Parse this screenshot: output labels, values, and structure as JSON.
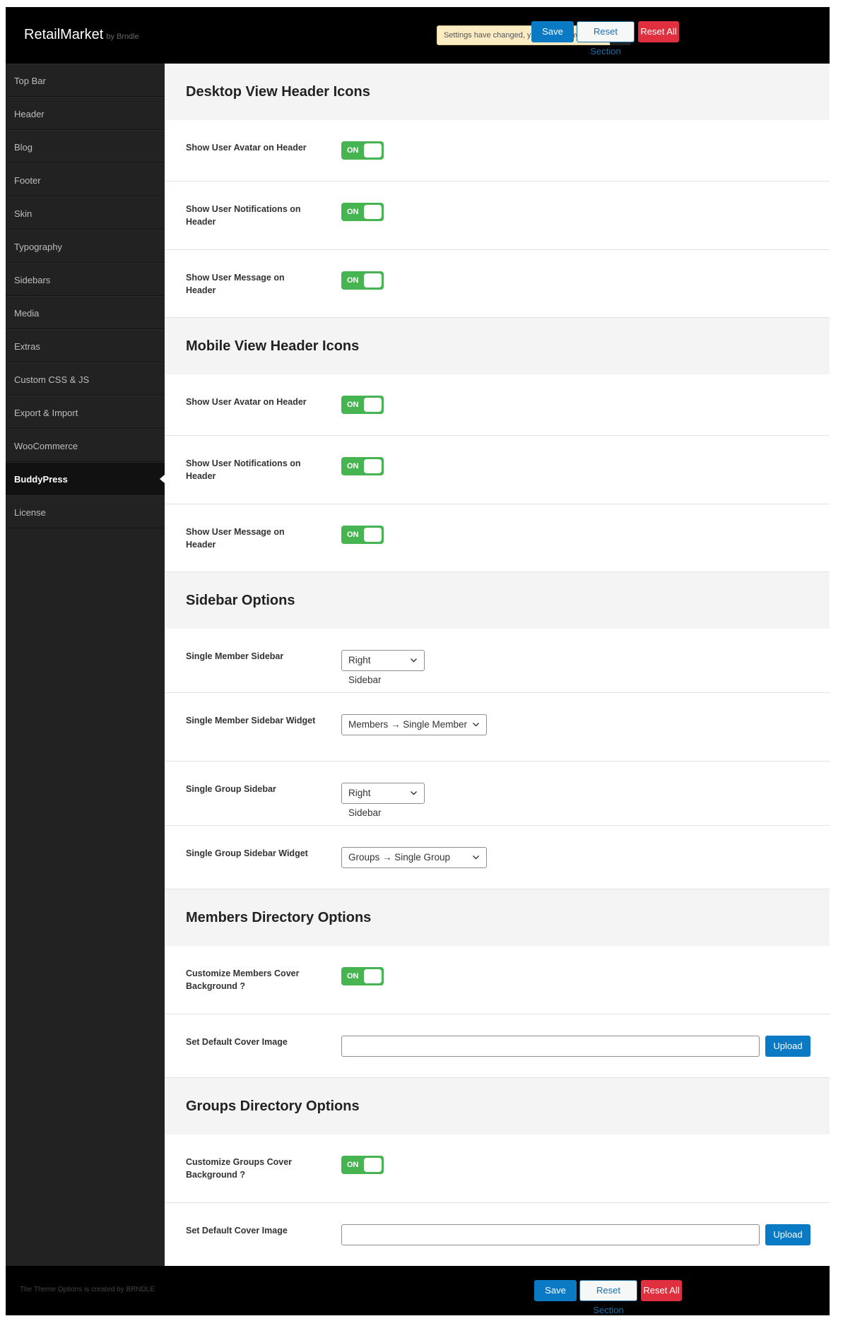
{
  "app": {
    "name": "RetailMarket",
    "by": "by Brndle"
  },
  "header": {
    "notice": "Settings have changed, you should save them!",
    "expand_icon": "expand-options-icon",
    "save_label": "Save",
    "reset_section_label": "Reset Section",
    "reset_all_label": "Reset All"
  },
  "sidebar": {
    "items": [
      {
        "label": "Top Bar"
      },
      {
        "label": "Header"
      },
      {
        "label": "Blog"
      },
      {
        "label": "Footer"
      },
      {
        "label": "Skin"
      },
      {
        "label": "Typography"
      },
      {
        "label": "Sidebars"
      },
      {
        "label": "Media"
      },
      {
        "label": "Extras"
      },
      {
        "label": "Custom CSS & JS"
      },
      {
        "label": "Export & Import"
      },
      {
        "label": "WooCommerce"
      },
      {
        "label": "BuddyPress",
        "active": true
      },
      {
        "label": "License"
      }
    ]
  },
  "sections": {
    "desktop": {
      "title": "Desktop View Header Icons",
      "rows": [
        {
          "label": "Show User Avatar on Header",
          "toggle": "ON"
        },
        {
          "label": "Show User Notifications on Header",
          "toggle": "ON"
        },
        {
          "label": "Show User Message on Header",
          "toggle": "ON"
        }
      ]
    },
    "mobile": {
      "title": "Mobile View Header Icons",
      "rows": [
        {
          "label": "Show User Avatar on Header",
          "toggle": "ON"
        },
        {
          "label": "Show User Notifications on Header",
          "toggle": "ON"
        },
        {
          "label": "Show User Message on Header",
          "toggle": "ON"
        }
      ]
    },
    "sidebar_opts": {
      "title": "Sidebar Options",
      "rows": [
        {
          "label": "Single Member Sidebar",
          "value": "Right Sidebar"
        },
        {
          "label": "Single Member Sidebar Widget",
          "value": "Members → Single Member"
        },
        {
          "label": "Single Group Sidebar",
          "value": "Right Sidebar"
        },
        {
          "label": "Single Group Sidebar Widget",
          "value": "Groups → Single Group"
        }
      ]
    },
    "members": {
      "title": "Members Directory Options",
      "rows": [
        {
          "label": "Customize Members Cover Background ?",
          "toggle": "ON"
        },
        {
          "label": "Set Default Cover Image",
          "input_value": "",
          "button": "Upload"
        }
      ]
    },
    "groups": {
      "title": "Groups Directory Options",
      "rows": [
        {
          "label": "Customize Groups Cover Background ?",
          "toggle": "ON"
        },
        {
          "label": "Set Default Cover Image",
          "input_value": "",
          "button": "Upload"
        }
      ]
    }
  },
  "footer": {
    "credit": "The Theme Options is created by BRNDLE",
    "save_label": "Save",
    "reset_section_label": "Reset Section",
    "reset_all_label": "Reset All"
  },
  "colors": {
    "accent_blue": "#0a7ac4",
    "toggle_green": "#46b450",
    "danger_red": "#e0303f",
    "notice_bg": "#fcecc4"
  }
}
